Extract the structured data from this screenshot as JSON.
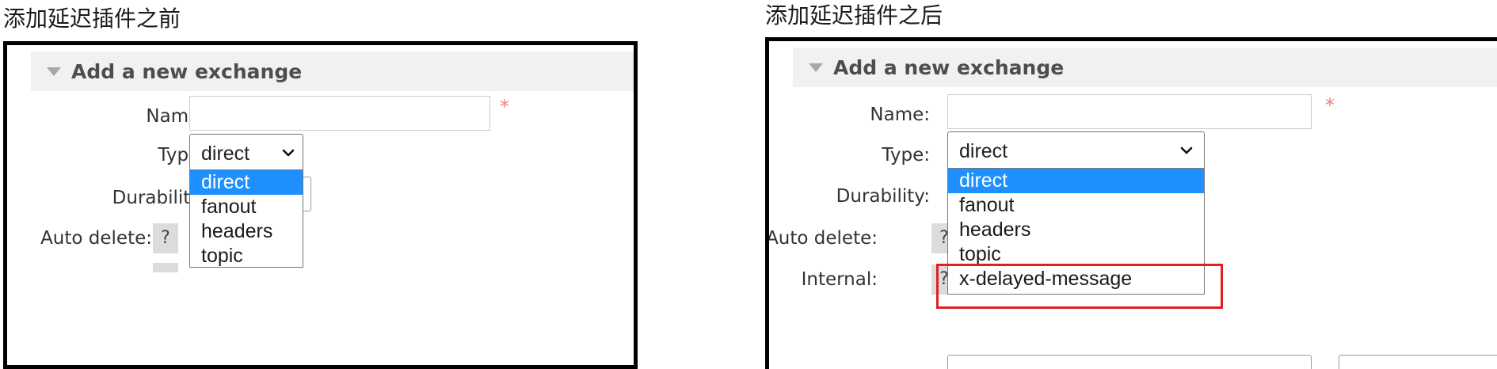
{
  "captions": {
    "before": "添加延迟插件之前",
    "after": "添加延迟插件之后"
  },
  "panel_title": "Add a new exchange",
  "fields": {
    "name_label": "Name:",
    "type_label": "Type:",
    "durability_label": "Durability:",
    "auto_delete_label": "Auto delete:",
    "internal_label": "Internal:",
    "help_glyph": "?",
    "required_mark": "*"
  },
  "before": {
    "type_selected": "direct",
    "type_options": [
      "direct",
      "fanout",
      "headers",
      "topic"
    ]
  },
  "after": {
    "type_selected": "direct",
    "type_options": [
      "direct",
      "fanout",
      "headers",
      "topic",
      "x-delayed-message"
    ]
  },
  "colors": {
    "selected_option": "#1e90ff",
    "highlight_box": "#e02020",
    "required_mark": "#e98080"
  },
  "icons": {
    "collapse": "triangle-down-icon",
    "select_arrow": "chevron-down-icon"
  }
}
